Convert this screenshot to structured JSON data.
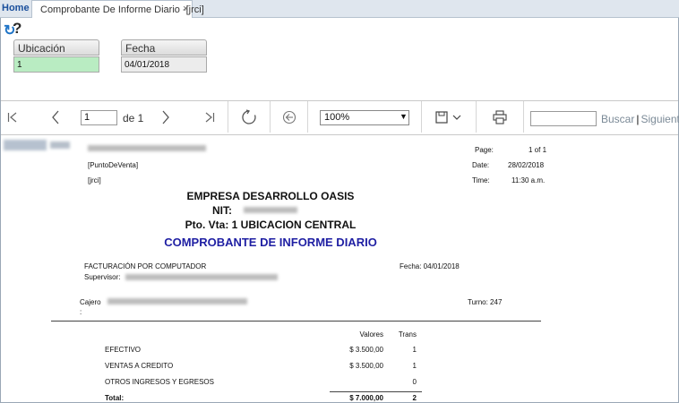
{
  "tabs": {
    "home": "Home",
    "active": "Comprobante De Informe Diario -[jrci]",
    "close": "×"
  },
  "toolbar": {
    "refresh_icon": "↻",
    "help_icon": "?"
  },
  "form": {
    "ubicacion_label": "Ubicación",
    "ubicacion_value": "1",
    "fecha_label": "Fecha",
    "fecha_value": "04/01/2018"
  },
  "viewer": {
    "page_value": "1",
    "page_of": "de 1",
    "zoom": "100%",
    "find_label": "Buscar",
    "next_label": "Siguiente"
  },
  "report": {
    "page_label": "Page:",
    "page_value": "1 of 1",
    "date_label": "Date:",
    "date_value": "28/02/2018",
    "time_label": "Time:",
    "time_value": "11:30 a.m.",
    "punto_venta": "[PuntoDeVenta]",
    "user": "[jrci]",
    "company": "EMPRESA DESARROLLO OASIS",
    "nit_label": "NIT:",
    "pto_vta": "Pto. Vta: 1 UBICACION CENTRAL",
    "title": "COMPROBANTE DE INFORME DIARIO",
    "facturacion": "FACTURACIÓN POR COMPUTADOR",
    "fecha": "Fecha: 04/01/2018",
    "supervisor_label": "Supervisor:",
    "cajero_label": "Cajero",
    "cajero_colon": ":",
    "turno": "Turno: 247",
    "col_valores": "Valores",
    "col_trans": "Trans",
    "rows": [
      {
        "label": "EFECTIVO",
        "valor": "$ 3.500,00",
        "trans": "1"
      },
      {
        "label": "VENTAS A CREDITO",
        "valor": "$ 3.500,00",
        "trans": "1"
      },
      {
        "label": "OTROS INGRESOS Y EGRESOS",
        "valor": "",
        "trans": "0"
      },
      {
        "label": "Total:",
        "valor": "$ 7.000,00",
        "trans": "2"
      }
    ]
  }
}
